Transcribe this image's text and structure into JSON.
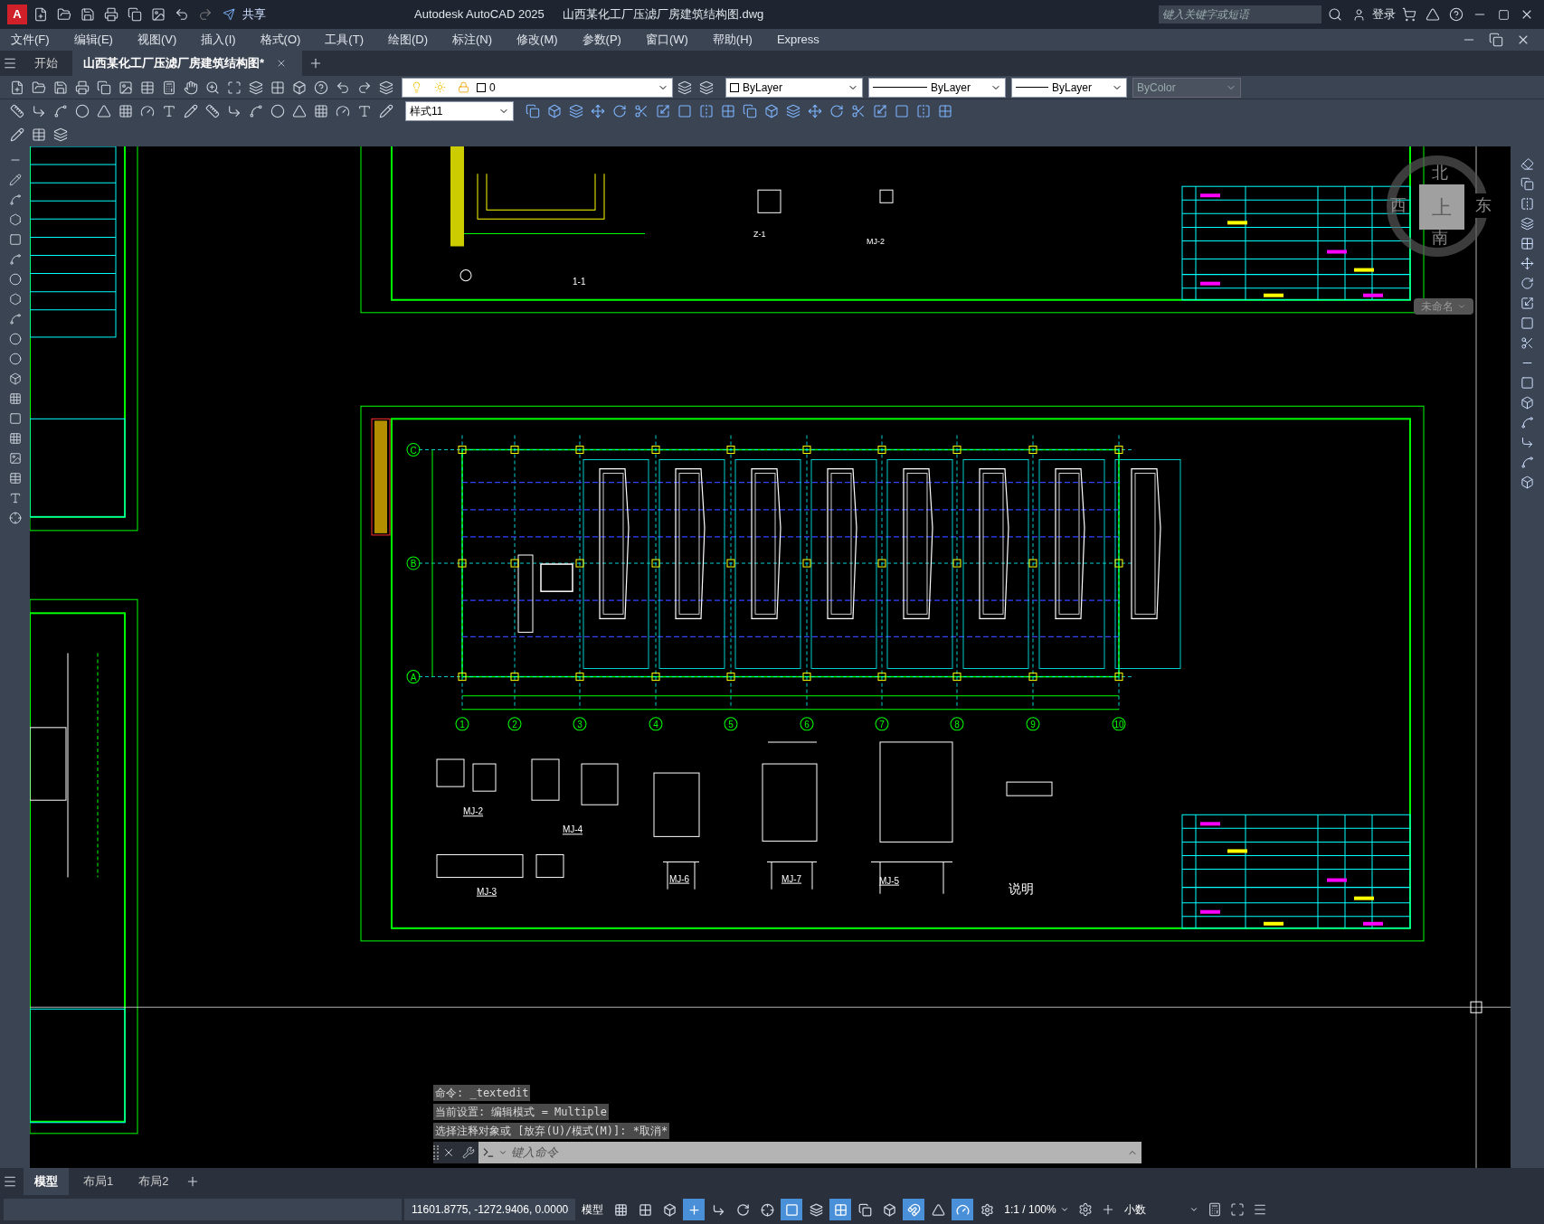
{
  "app": {
    "logo": "A",
    "share": "共享",
    "product": "Autodesk AutoCAD 2025",
    "file": "山西某化工厂压滤厂房建筑结构图.dwg",
    "search_placeholder": "键入关键字或短语",
    "login": "登录"
  },
  "menu": [
    "文件(F)",
    "编辑(E)",
    "视图(V)",
    "插入(I)",
    "格式(O)",
    "工具(T)",
    "绘图(D)",
    "标注(N)",
    "修改(M)",
    "参数(P)",
    "窗口(W)",
    "帮助(H)",
    "Express"
  ],
  "doc_tabs": [
    {
      "label": "开始",
      "selected": false
    },
    {
      "label": "山西某化工厂压滤厂房建筑结构图*",
      "selected": true
    }
  ],
  "properties": {
    "layer": "0",
    "colour": "ByLayer",
    "linetype": "ByLayer",
    "lineweight": "ByLayer",
    "plotstyle": "ByColor"
  },
  "dim_style": "样式11",
  "viewcube": {
    "north": "北",
    "south": "南",
    "east": "东",
    "west": "西",
    "face": "上",
    "wcs": "未命名"
  },
  "drawing": {
    "grid_numbers": [
      "1",
      "2",
      "3",
      "4",
      "5",
      "6",
      "7",
      "8",
      "9",
      "10"
    ],
    "grid_letters": [
      "C",
      "B",
      "A"
    ],
    "top_labels": [
      "1-1",
      "Z-1",
      "MJ-2"
    ],
    "details": [
      "MJ-2",
      "MJ-4",
      "MJ-3",
      "MJ-6",
      "MJ-7",
      "MJ-5"
    ],
    "note_title": "说明"
  },
  "command": {
    "history": [
      "命令: _textedit",
      "当前设置: 编辑模式 = Multiple",
      "选择注释对象或 [放弃(U)/模式(M)]: *取消*"
    ],
    "placeholder": "键入命令"
  },
  "layout_tabs": [
    {
      "label": "模型",
      "selected": true
    },
    {
      "label": "布局1",
      "selected": false
    },
    {
      "label": "布局2",
      "selected": false
    }
  ],
  "status": {
    "coords": "11601.8775, -1272.9406, 0.0000",
    "space": "模型",
    "scale": "1:1 / 100%",
    "units": "小数"
  },
  "toggles": [
    {
      "on": false
    },
    {
      "on": false
    },
    {
      "on": false
    },
    {
      "on": true
    },
    {
      "on": false
    },
    {
      "on": false
    },
    {
      "on": false
    },
    {
      "on": true
    },
    {
      "on": false
    },
    {
      "on": true
    },
    {
      "on": false
    },
    {
      "on": false
    },
    {
      "on": true
    },
    {
      "on": false
    },
    {
      "on": true
    },
    {
      "on": false
    }
  ]
}
